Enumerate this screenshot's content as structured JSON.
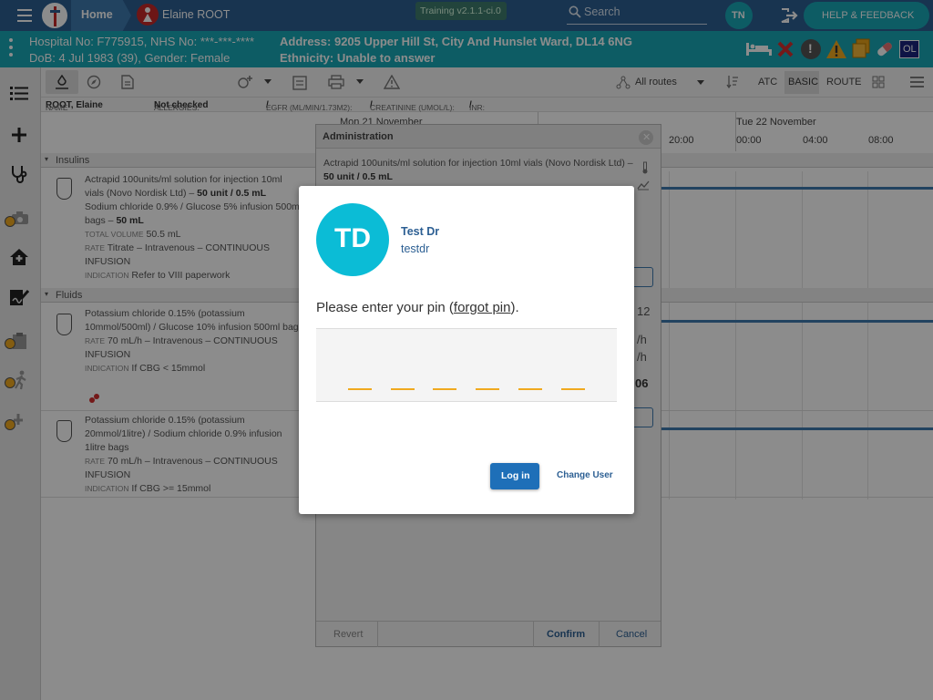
{
  "topbar": {
    "home_label": "Home",
    "patient_name": "Elaine ROOT",
    "version_badge": "Training v2.1.1-ci.0",
    "search_placeholder": "Search",
    "user_initials": "TN",
    "help_label": "HELP & FEEDBACK"
  },
  "banner": {
    "hospital_no": "Hospital No: F775915, NHS No: ***-***-****",
    "dob": "DoB: 4 Jul 1983 (39), Gender: Female",
    "address": "Address: 9205 Upper Hill St, City And Hunslet Ward, DL14 6NG",
    "ethnicity": "Ethnicity: Unable to answer",
    "badge_ol": "OL"
  },
  "toolbar": {
    "routes_label": "All routes",
    "atc_label": "ATC",
    "basic_label": "BASIC",
    "route_label": "ROUTE"
  },
  "infobar": {
    "name_label": "NAME",
    "name_value": "ROOT, Elaine",
    "allergies_label": "ALLERGIES:",
    "allergies_value": "Not checked",
    "egfr_label": "EGFR (ML/MIN/1.73M2):",
    "egfr_value": "/",
    "creat_label": "CREATININE (UMOL/L):",
    "creat_value": "/",
    "inr_label": "INR:",
    "inr_value": "/"
  },
  "timeline": {
    "day1": "Mon 21 November",
    "day2": "Tue 22 November",
    "hours": [
      "20:00",
      "00:00",
      "04:00",
      "08:00"
    ]
  },
  "sections": {
    "insulins": "Insulins",
    "fluids": "Fluids"
  },
  "drugs": [
    {
      "name": "Actrapid 100units/ml solution for injection 10ml vials (Novo Nordisk Ltd) –",
      "dose": "50 unit / 0.5 mL",
      "diluent": "Sodium chloride 0.9% / Glucose 5% infusion 500ml bags –",
      "diluent_dose": "50 mL",
      "total_label": "TOTAL VOLUME",
      "total_value": "50.5 mL",
      "rate_label": "RATE",
      "rate_value": "Titrate – Intravenous – CONTINUOUS INFUSION",
      "ind_label": "INDICATION",
      "ind_value": "Refer to VIII paperwork"
    },
    {
      "name": "Potassium chloride 0.15% (potassium 10mmol/500ml) / Glucose 10% infusion 500ml bags",
      "rate_label": "RATE",
      "rate_value": "70 mL/h – Intravenous – CONTINUOUS INFUSION",
      "ind_label": "INDICATION",
      "ind_value": "If CBG < 15mmol"
    },
    {
      "name": "Potassium chloride 0.15% (potassium 20mmol/1litre) / Sodium chloride 0.9% infusion 1litre bags",
      "rate_label": "RATE",
      "rate_value": "70 mL/h – Intravenous – CONTINUOUS INFUSION",
      "ind_label": "INDICATION",
      "ind_value": "If CBG >= 15mmol"
    }
  ],
  "admin_panel": {
    "title": "Administration",
    "drug_text": "Actrapid 100units/ml solution for injection 10ml vials (Novo Nordisk Ltd) –",
    "drug_dose": "50 unit / 0.5 mL",
    "frag_12": "12",
    "frag_lh1": "/h",
    "frag_lh2": "/h",
    "frag_06": "06",
    "revert_label": "Revert",
    "confirm_label": "Confirm",
    "cancel_label": "Cancel"
  },
  "pin_dialog": {
    "avatar_initials": "TD",
    "user_name": "Test Dr",
    "username": "testdr",
    "prompt_before": "Please enter your pin (",
    "forgot_link": "forgot pin",
    "prompt_after": ").",
    "login_label": "Log in",
    "change_user_label": "Change User"
  },
  "colors": {
    "topbar": "#2c5f93",
    "banner": "#18a8b6",
    "accent": "#f0a91f",
    "primary_button": "#1e6fb8",
    "avatar": "#0bbcd6"
  }
}
